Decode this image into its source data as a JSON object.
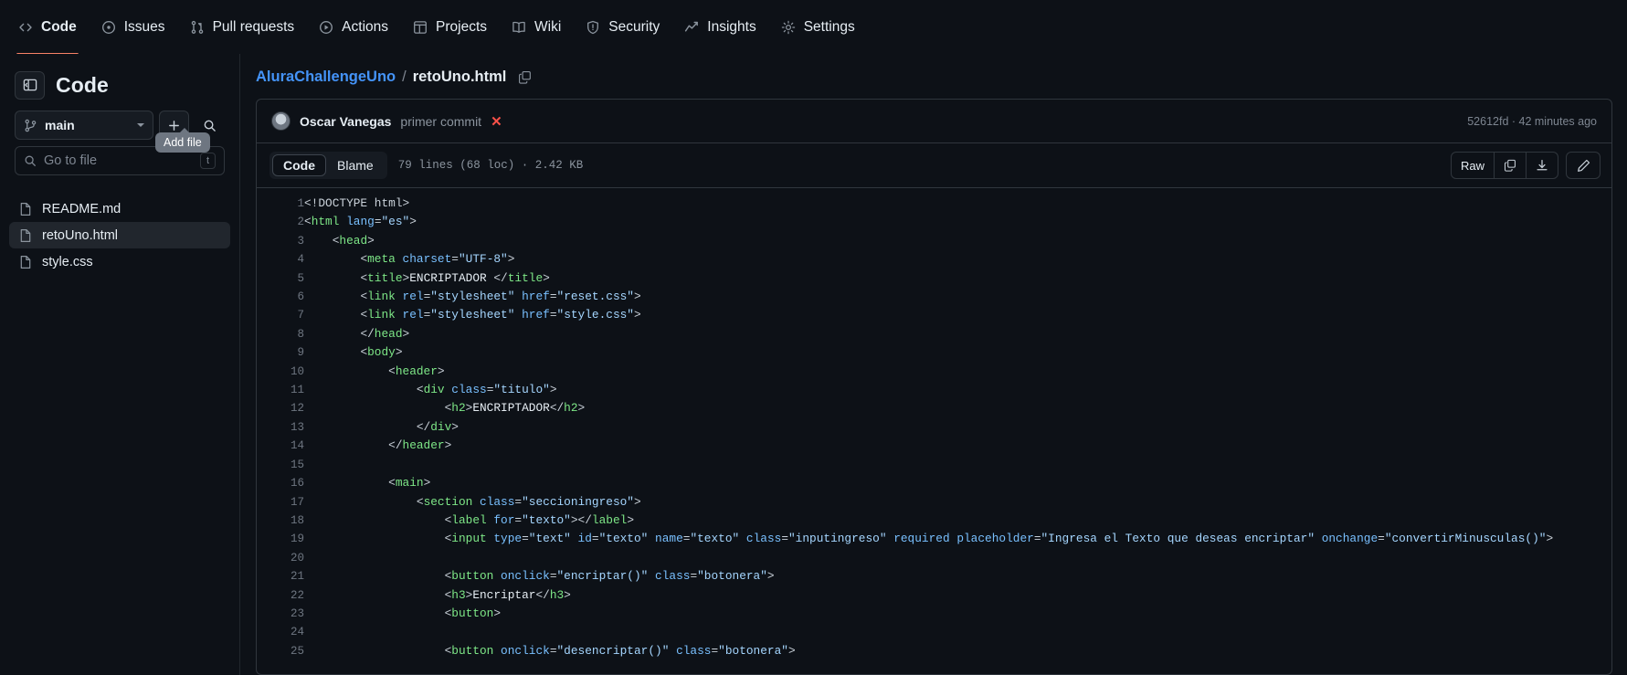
{
  "repo_nav": {
    "items": [
      {
        "label": "Code",
        "icon": "code-icon",
        "active": true
      },
      {
        "label": "Issues",
        "icon": "issue-opened-icon",
        "active": false
      },
      {
        "label": "Pull requests",
        "icon": "git-pull-request-icon",
        "active": false
      },
      {
        "label": "Actions",
        "icon": "play-icon",
        "active": false
      },
      {
        "label": "Projects",
        "icon": "project-icon",
        "active": false
      },
      {
        "label": "Wiki",
        "icon": "book-icon",
        "active": false
      },
      {
        "label": "Security",
        "icon": "shield-icon",
        "active": false
      },
      {
        "label": "Insights",
        "icon": "graph-icon",
        "active": false
      },
      {
        "label": "Settings",
        "icon": "gear-icon",
        "active": false
      }
    ]
  },
  "sidebar": {
    "title": "Code",
    "panel_toggle_icon": "sidebar-collapse-icon",
    "branch": {
      "name": "main",
      "icon": "git-branch-icon"
    },
    "add_file_icon": "plus-icon",
    "search_icon": "search-icon",
    "tooltip": "Add file",
    "file_filter": {
      "placeholder": "Go to file",
      "icon": "search-icon",
      "kbd": "t"
    },
    "files": [
      {
        "name": "README.md",
        "icon": "file-icon",
        "selected": false
      },
      {
        "name": "retoUno.html",
        "icon": "file-icon",
        "selected": true
      },
      {
        "name": "style.css",
        "icon": "file-icon",
        "selected": false
      }
    ]
  },
  "breadcrumb": {
    "repo": "AluraChallengeUno",
    "separator": "/",
    "file": "retoUno.html",
    "copy_icon": "copy-path-icon"
  },
  "commit": {
    "author": "Oscar Vanegas",
    "message": "primer commit",
    "status_icon": "x-status-icon",
    "status_glyph": "✕",
    "sha": "52612fd",
    "separator": "·",
    "time": "42 minutes ago",
    "meta": "52612fd · 42 minutes ago"
  },
  "toolbar": {
    "tabs": [
      {
        "label": "Code",
        "active": true
      },
      {
        "label": "Blame",
        "active": false
      }
    ],
    "file_meta": "79 lines (68 loc) · 2.42 KB",
    "raw_label": "Raw",
    "copy_icon": "copy-icon",
    "download_icon": "download-icon",
    "edit_icon": "pencil-icon"
  },
  "colors": {
    "accent_underline": "#f78166",
    "link": "#4493f8",
    "danger": "#f85149",
    "bg": "#0d1117",
    "border": "#30363d",
    "muted": "#8b949e",
    "syntax_tag": "#7ee787",
    "syntax_attr": "#79c0ff",
    "syntax_string": "#a5d6ff"
  },
  "code": {
    "language": "html",
    "lines": [
      {
        "n": 1,
        "indent": 0,
        "tokens": [
          {
            "t": "pun",
            "v": "<!DOCTYPE html>"
          }
        ]
      },
      {
        "n": 2,
        "indent": 0,
        "tokens": [
          {
            "t": "pun",
            "v": "<"
          },
          {
            "t": "tag",
            "v": "html"
          },
          {
            "t": "txt",
            "v": " "
          },
          {
            "t": "attr",
            "v": "lang"
          },
          {
            "t": "pun",
            "v": "="
          },
          {
            "t": "str",
            "v": "\"es\""
          },
          {
            "t": "pun",
            "v": ">"
          }
        ]
      },
      {
        "n": 3,
        "indent": 1,
        "tokens": [
          {
            "t": "pun",
            "v": "<"
          },
          {
            "t": "tag",
            "v": "head"
          },
          {
            "t": "pun",
            "v": ">"
          }
        ]
      },
      {
        "n": 4,
        "indent": 2,
        "tokens": [
          {
            "t": "pun",
            "v": "<"
          },
          {
            "t": "tag",
            "v": "meta"
          },
          {
            "t": "txt",
            "v": " "
          },
          {
            "t": "attr",
            "v": "charset"
          },
          {
            "t": "pun",
            "v": "="
          },
          {
            "t": "str",
            "v": "\"UTF-8\""
          },
          {
            "t": "pun",
            "v": ">"
          }
        ]
      },
      {
        "n": 5,
        "indent": 2,
        "tokens": [
          {
            "t": "pun",
            "v": "<"
          },
          {
            "t": "tag",
            "v": "title"
          },
          {
            "t": "pun",
            "v": ">"
          },
          {
            "t": "txt",
            "v": "ENCRIPTADOR "
          },
          {
            "t": "pun",
            "v": "</"
          },
          {
            "t": "tag",
            "v": "title"
          },
          {
            "t": "pun",
            "v": ">"
          }
        ]
      },
      {
        "n": 6,
        "indent": 2,
        "tokens": [
          {
            "t": "pun",
            "v": "<"
          },
          {
            "t": "tag",
            "v": "link"
          },
          {
            "t": "txt",
            "v": " "
          },
          {
            "t": "attr",
            "v": "rel"
          },
          {
            "t": "pun",
            "v": "="
          },
          {
            "t": "str",
            "v": "\"stylesheet\""
          },
          {
            "t": "txt",
            "v": " "
          },
          {
            "t": "attr",
            "v": "href"
          },
          {
            "t": "pun",
            "v": "="
          },
          {
            "t": "str",
            "v": "\"reset.css\""
          },
          {
            "t": "pun",
            "v": ">"
          }
        ]
      },
      {
        "n": 7,
        "indent": 2,
        "tokens": [
          {
            "t": "pun",
            "v": "<"
          },
          {
            "t": "tag",
            "v": "link"
          },
          {
            "t": "txt",
            "v": " "
          },
          {
            "t": "attr",
            "v": "rel"
          },
          {
            "t": "pun",
            "v": "="
          },
          {
            "t": "str",
            "v": "\"stylesheet\""
          },
          {
            "t": "txt",
            "v": " "
          },
          {
            "t": "attr",
            "v": "href"
          },
          {
            "t": "pun",
            "v": "="
          },
          {
            "t": "str",
            "v": "\"style.css\""
          },
          {
            "t": "pun",
            "v": ">"
          }
        ]
      },
      {
        "n": 8,
        "indent": 2,
        "tokens": [
          {
            "t": "pun",
            "v": "</"
          },
          {
            "t": "tag",
            "v": "head"
          },
          {
            "t": "pun",
            "v": ">"
          }
        ]
      },
      {
        "n": 9,
        "indent": 2,
        "tokens": [
          {
            "t": "pun",
            "v": "<"
          },
          {
            "t": "tag",
            "v": "body"
          },
          {
            "t": "pun",
            "v": ">"
          }
        ]
      },
      {
        "n": 10,
        "indent": 3,
        "tokens": [
          {
            "t": "pun",
            "v": "<"
          },
          {
            "t": "tag",
            "v": "header"
          },
          {
            "t": "pun",
            "v": ">"
          }
        ]
      },
      {
        "n": 11,
        "indent": 4,
        "tokens": [
          {
            "t": "pun",
            "v": "<"
          },
          {
            "t": "tag",
            "v": "div"
          },
          {
            "t": "txt",
            "v": " "
          },
          {
            "t": "attr",
            "v": "class"
          },
          {
            "t": "pun",
            "v": "="
          },
          {
            "t": "str",
            "v": "\"titulo\""
          },
          {
            "t": "pun",
            "v": ">"
          }
        ]
      },
      {
        "n": 12,
        "indent": 5,
        "tokens": [
          {
            "t": "pun",
            "v": "<"
          },
          {
            "t": "tag",
            "v": "h2"
          },
          {
            "t": "pun",
            "v": ">"
          },
          {
            "t": "txt",
            "v": "ENCRIPTADOR"
          },
          {
            "t": "pun",
            "v": "</"
          },
          {
            "t": "tag",
            "v": "h2"
          },
          {
            "t": "pun",
            "v": ">"
          }
        ]
      },
      {
        "n": 13,
        "indent": 4,
        "tokens": [
          {
            "t": "pun",
            "v": "</"
          },
          {
            "t": "tag",
            "v": "div"
          },
          {
            "t": "pun",
            "v": ">"
          }
        ]
      },
      {
        "n": 14,
        "indent": 3,
        "tokens": [
          {
            "t": "pun",
            "v": "</"
          },
          {
            "t": "tag",
            "v": "header"
          },
          {
            "t": "pun",
            "v": ">"
          }
        ]
      },
      {
        "n": 15,
        "indent": 0,
        "tokens": []
      },
      {
        "n": 16,
        "indent": 3,
        "tokens": [
          {
            "t": "pun",
            "v": "<"
          },
          {
            "t": "tag",
            "v": "main"
          },
          {
            "t": "pun",
            "v": ">"
          }
        ]
      },
      {
        "n": 17,
        "indent": 4,
        "tokens": [
          {
            "t": "pun",
            "v": "<"
          },
          {
            "t": "tag",
            "v": "section"
          },
          {
            "t": "txt",
            "v": " "
          },
          {
            "t": "attr",
            "v": "class"
          },
          {
            "t": "pun",
            "v": "="
          },
          {
            "t": "str",
            "v": "\"seccioningreso\""
          },
          {
            "t": "pun",
            "v": ">"
          }
        ]
      },
      {
        "n": 18,
        "indent": 5,
        "tokens": [
          {
            "t": "pun",
            "v": "<"
          },
          {
            "t": "tag",
            "v": "label"
          },
          {
            "t": "txt",
            "v": " "
          },
          {
            "t": "attr",
            "v": "for"
          },
          {
            "t": "pun",
            "v": "="
          },
          {
            "t": "str",
            "v": "\"texto\""
          },
          {
            "t": "pun",
            "v": "></"
          },
          {
            "t": "tag",
            "v": "label"
          },
          {
            "t": "pun",
            "v": ">"
          }
        ]
      },
      {
        "n": 19,
        "indent": 5,
        "tokens": [
          {
            "t": "pun",
            "v": "<"
          },
          {
            "t": "tag",
            "v": "input"
          },
          {
            "t": "txt",
            "v": " "
          },
          {
            "t": "attr",
            "v": "type"
          },
          {
            "t": "pun",
            "v": "="
          },
          {
            "t": "str",
            "v": "\"text\""
          },
          {
            "t": "txt",
            "v": " "
          },
          {
            "t": "attr",
            "v": "id"
          },
          {
            "t": "pun",
            "v": "="
          },
          {
            "t": "str",
            "v": "\"texto\""
          },
          {
            "t": "txt",
            "v": " "
          },
          {
            "t": "attr",
            "v": "name"
          },
          {
            "t": "pun",
            "v": "="
          },
          {
            "t": "str",
            "v": "\"texto\""
          },
          {
            "t": "txt",
            "v": " "
          },
          {
            "t": "attr",
            "v": "class"
          },
          {
            "t": "pun",
            "v": "="
          },
          {
            "t": "str",
            "v": "\"inputingreso\""
          },
          {
            "t": "txt",
            "v": " "
          },
          {
            "t": "attr",
            "v": "required"
          },
          {
            "t": "txt",
            "v": " "
          },
          {
            "t": "attr",
            "v": "placeholder"
          },
          {
            "t": "pun",
            "v": "="
          },
          {
            "t": "str",
            "v": "\"Ingresa el Texto que deseas encriptar\""
          },
          {
            "t": "txt",
            "v": " "
          },
          {
            "t": "attr",
            "v": "onchange"
          },
          {
            "t": "pun",
            "v": "="
          },
          {
            "t": "str",
            "v": "\"convertirMinusculas()\""
          },
          {
            "t": "pun",
            "v": ">"
          }
        ]
      },
      {
        "n": 20,
        "indent": 0,
        "tokens": []
      },
      {
        "n": 21,
        "indent": 5,
        "tokens": [
          {
            "t": "pun",
            "v": "<"
          },
          {
            "t": "tag",
            "v": "button"
          },
          {
            "t": "txt",
            "v": " "
          },
          {
            "t": "attr",
            "v": "onclick"
          },
          {
            "t": "pun",
            "v": "="
          },
          {
            "t": "str",
            "v": "\"encriptar()\""
          },
          {
            "t": "txt",
            "v": " "
          },
          {
            "t": "attr",
            "v": "class"
          },
          {
            "t": "pun",
            "v": "="
          },
          {
            "t": "str",
            "v": "\"botonera\""
          },
          {
            "t": "pun",
            "v": ">"
          }
        ]
      },
      {
        "n": 22,
        "indent": 5,
        "tokens": [
          {
            "t": "pun",
            "v": "<"
          },
          {
            "t": "tag",
            "v": "h3"
          },
          {
            "t": "pun",
            "v": ">"
          },
          {
            "t": "txt",
            "v": "Encriptar"
          },
          {
            "t": "pun",
            "v": "</"
          },
          {
            "t": "tag",
            "v": "h3"
          },
          {
            "t": "pun",
            "v": ">"
          }
        ]
      },
      {
        "n": 23,
        "indent": 5,
        "tokens": [
          {
            "t": "pun",
            "v": "<"
          },
          {
            "t": "tag",
            "v": "button"
          },
          {
            "t": "pun",
            "v": ">"
          }
        ]
      },
      {
        "n": 24,
        "indent": 0,
        "tokens": []
      },
      {
        "n": 25,
        "indent": 5,
        "tokens": [
          {
            "t": "pun",
            "v": "<"
          },
          {
            "t": "tag",
            "v": "button"
          },
          {
            "t": "txt",
            "v": " "
          },
          {
            "t": "attr",
            "v": "onclick"
          },
          {
            "t": "pun",
            "v": "="
          },
          {
            "t": "str",
            "v": "\"desencriptar()\""
          },
          {
            "t": "txt",
            "v": " "
          },
          {
            "t": "attr",
            "v": "class"
          },
          {
            "t": "pun",
            "v": "="
          },
          {
            "t": "str",
            "v": "\"botonera\""
          },
          {
            "t": "pun",
            "v": ">"
          }
        ]
      }
    ]
  }
}
